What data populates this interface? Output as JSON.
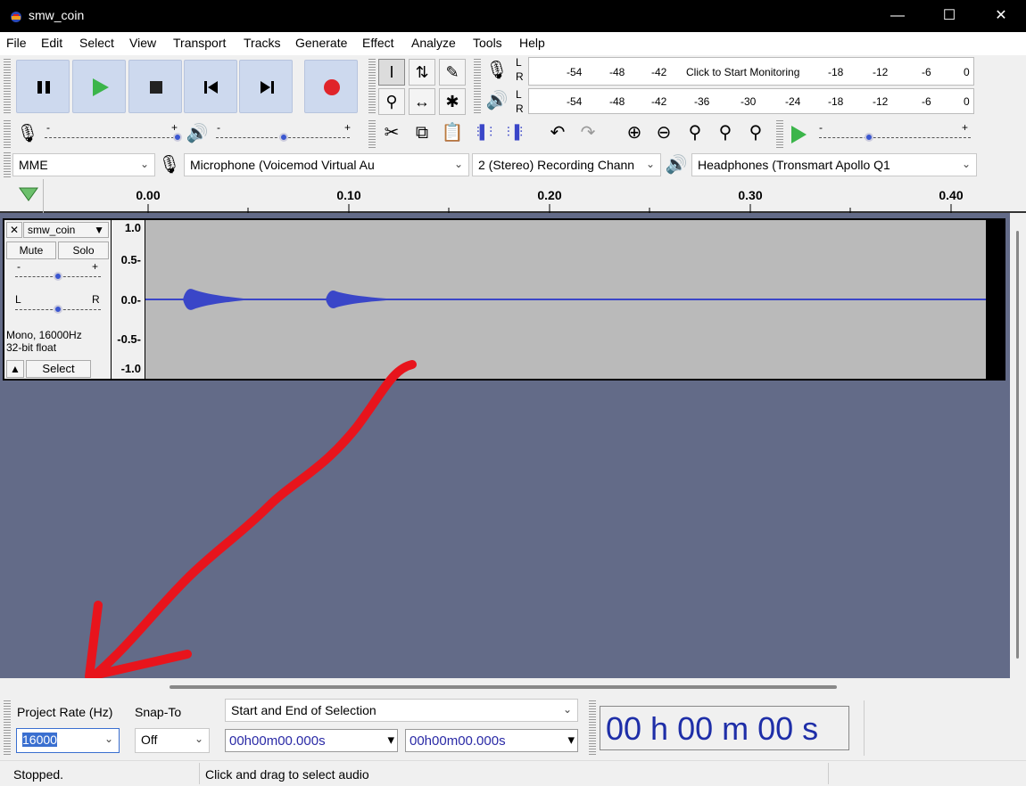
{
  "window": {
    "title": "smw_coin",
    "minimize": "—",
    "maximize": "☐",
    "close": "✕"
  },
  "menu": [
    "File",
    "Edit",
    "Select",
    "View",
    "Transport",
    "Tracks",
    "Generate",
    "Effect",
    "Analyze",
    "Tools",
    "Help"
  ],
  "transport": {
    "pause": "pause",
    "play": "play",
    "stop": "stop",
    "skip_start": "skip-to-start",
    "skip_end": "skip-to-end",
    "record": "record"
  },
  "meters": {
    "rec_ticks": [
      "-54",
      "-48",
      "-42",
      "-18",
      "-12",
      "-6",
      "0"
    ],
    "monitor_label": "Click to Start Monitoring",
    "play_ticks": [
      "-54",
      "-48",
      "-42",
      "-36",
      "-30",
      "-24",
      "-18",
      "-12",
      "-6",
      "0"
    ],
    "L": "L",
    "R": "R"
  },
  "mixer": {
    "minus": "-",
    "plus": "+"
  },
  "devices": {
    "host": "MME",
    "mic": "Microphone (Voicemod Virtual Au",
    "channels": "2 (Stereo) Recording Chann",
    "output": "Headphones (Tronsmart Apollo Q1"
  },
  "ruler": [
    "0.00",
    "0.10",
    "0.20",
    "0.30",
    "0.40"
  ],
  "track": {
    "name": "smw_coin",
    "mute": "Mute",
    "solo": "Solo",
    "gain_minus": "-",
    "gain_plus": "+",
    "pan_l": "L",
    "pan_r": "R",
    "info1": "Mono, 16000Hz",
    "info2": "32-bit float",
    "select": "Select",
    "close": "✕",
    "vticks": [
      "1.0",
      "0.5-",
      "0.0-",
      "-0.5-",
      "-1.0"
    ]
  },
  "bottom": {
    "rate_label": "Project Rate (Hz)",
    "rate_value": "16000",
    "snap_label": "Snap-To",
    "snap_value": "Off",
    "selection_mode": "Start and End of Selection",
    "start_time": "00h00m00.000s",
    "end_time": "00h00m00.000s",
    "big_time": "00 h 00 m 00 s"
  },
  "status": {
    "left": "Stopped.",
    "main": "Click and drag to select audio"
  },
  "colors": {
    "accent": "#3a46c8",
    "record": "#e0242a",
    "play": "#3bb54a",
    "annotation": "#e8141c",
    "trackbg": "#636b88"
  }
}
